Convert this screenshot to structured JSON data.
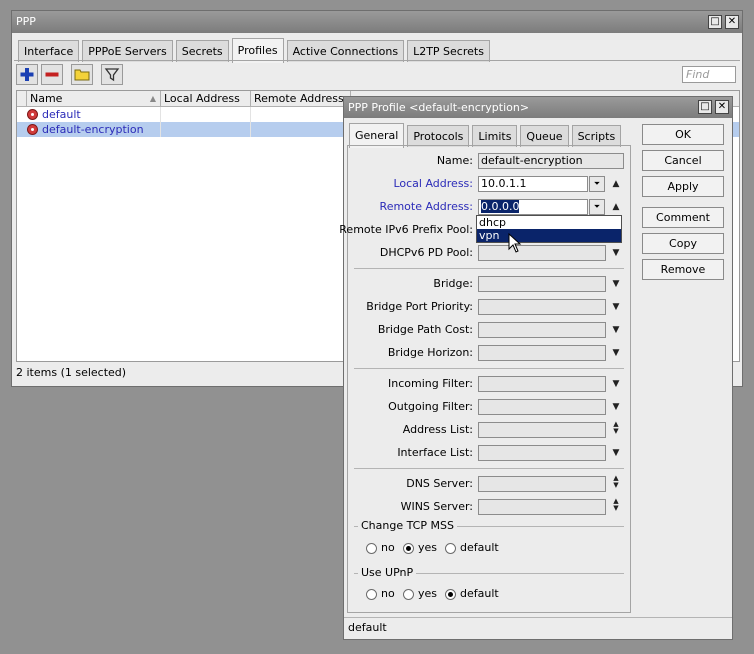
{
  "ppp_window": {
    "title": "PPP",
    "tabs": [
      {
        "label": "Interface",
        "active": false
      },
      {
        "label": "PPPoE Servers",
        "active": false
      },
      {
        "label": "Secrets",
        "active": false
      },
      {
        "label": "Profiles",
        "active": true
      },
      {
        "label": "Active Connections",
        "active": false
      },
      {
        "label": "L2TP Secrets",
        "active": false
      }
    ],
    "toolbar": {
      "add_icon": "plus-icon",
      "remove_icon": "minus-icon",
      "comment_icon": "comment-icon",
      "filter_icon": "filter-icon",
      "find_placeholder": "Find"
    },
    "table": {
      "columns": [
        "Name",
        "Local Address",
        "Remote Address"
      ],
      "rows": [
        {
          "name": "default",
          "local_address": "",
          "remote_address": "",
          "selected": false
        },
        {
          "name": "default-encryption",
          "local_address": "",
          "remote_address": "",
          "selected": true
        }
      ]
    },
    "status": "2 items (1 selected)"
  },
  "profile_dialog": {
    "title": "PPP Profile <default-encryption>",
    "tabs": [
      {
        "label": "General",
        "active": true
      },
      {
        "label": "Protocols",
        "active": false
      },
      {
        "label": "Limits",
        "active": false
      },
      {
        "label": "Queue",
        "active": false
      },
      {
        "label": "Scripts",
        "active": false
      }
    ],
    "fields": {
      "name": {
        "label": "Name:",
        "value": "default-encryption"
      },
      "local_address": {
        "label": "Local Address:",
        "value": "10.0.1.1"
      },
      "remote_address": {
        "label": "Remote Address:",
        "value": "0.0.0.0"
      },
      "remote_ipv6_prefix_pool": {
        "label": "Remote IPv6 Prefix Pool:",
        "value": ""
      },
      "dhcpv6_pd_pool": {
        "label": "DHCPv6 PD Pool:",
        "value": ""
      },
      "bridge": {
        "label": "Bridge:",
        "value": ""
      },
      "bridge_port_priority": {
        "label": "Bridge Port Priority:",
        "value": ""
      },
      "bridge_path_cost": {
        "label": "Bridge Path Cost:",
        "value": ""
      },
      "bridge_horizon": {
        "label": "Bridge Horizon:",
        "value": ""
      },
      "incoming_filter": {
        "label": "Incoming Filter:",
        "value": ""
      },
      "outgoing_filter": {
        "label": "Outgoing Filter:",
        "value": ""
      },
      "address_list": {
        "label": "Address List:",
        "value": ""
      },
      "interface_list": {
        "label": "Interface List:",
        "value": ""
      },
      "dns_server": {
        "label": "DNS Server:",
        "value": ""
      },
      "wins_server": {
        "label": "WINS Server:",
        "value": ""
      }
    },
    "remote_address_dropdown": {
      "options": [
        "dhcp",
        "vpn"
      ],
      "hovered": "vpn"
    },
    "change_tcp_mss": {
      "label": "Change TCP MSS",
      "options": [
        "no",
        "yes",
        "default"
      ],
      "selected": "yes"
    },
    "use_upnp": {
      "label": "Use UPnP",
      "options": [
        "no",
        "yes",
        "default"
      ],
      "selected": "default"
    },
    "buttons": [
      "OK",
      "Cancel",
      "Apply",
      "Comment",
      "Copy",
      "Remove"
    ],
    "status": "default"
  }
}
